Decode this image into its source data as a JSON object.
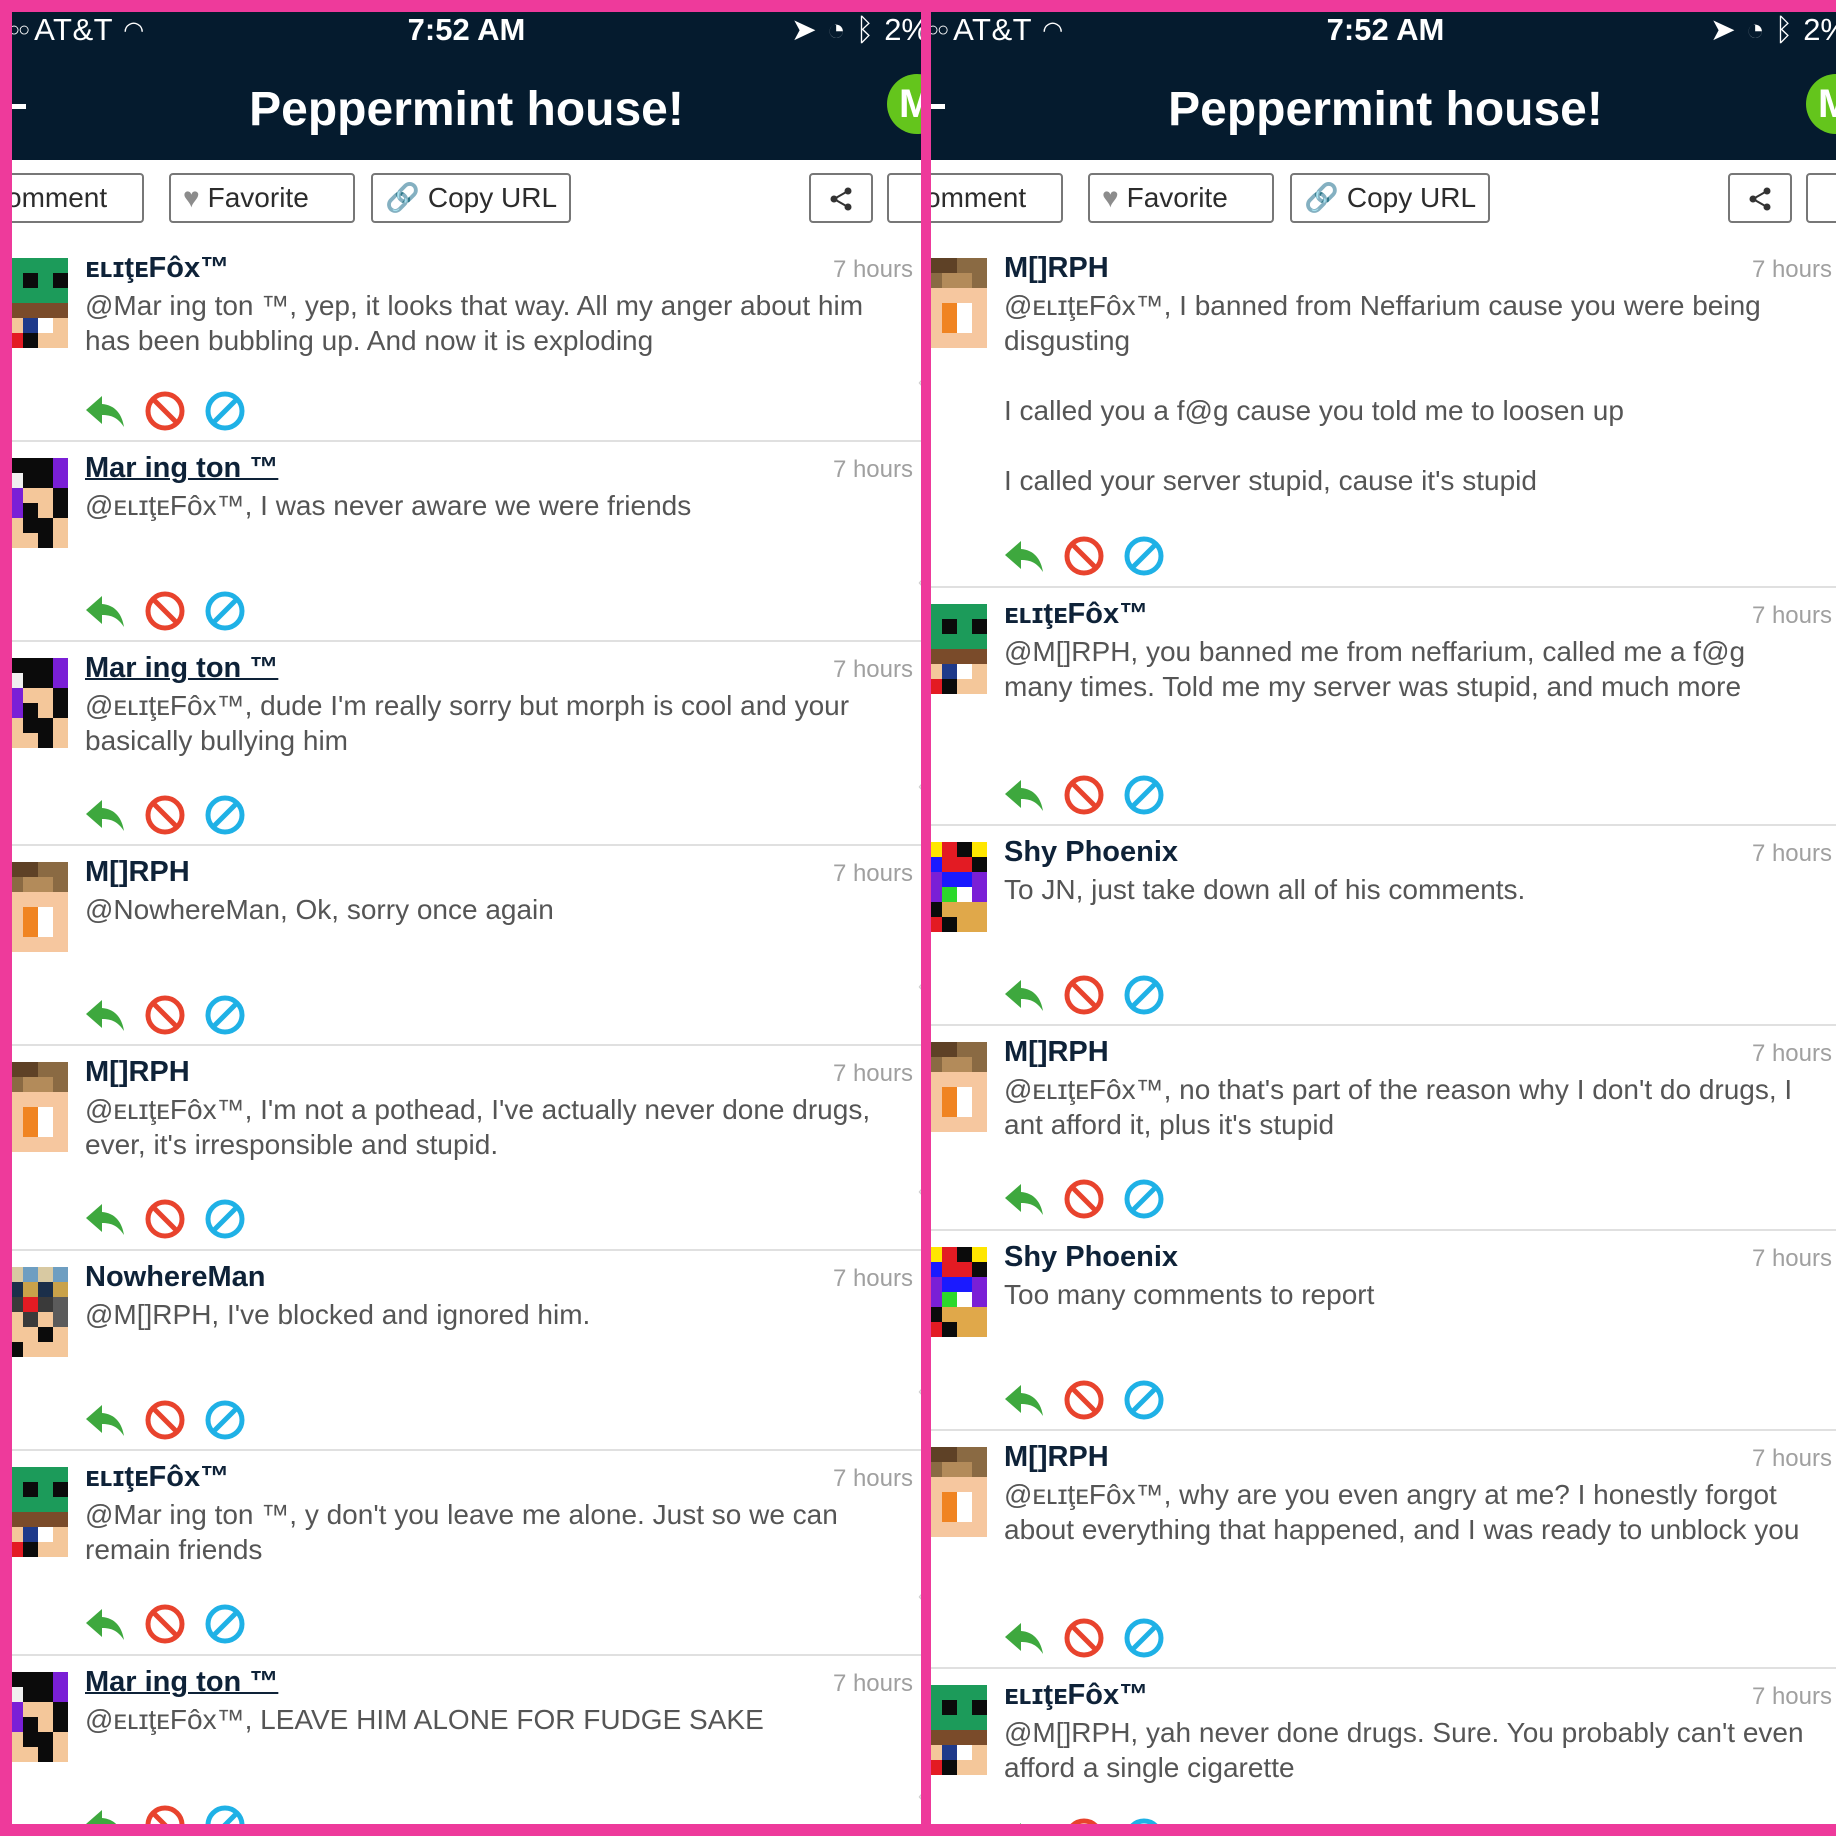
{
  "panels": [
    {
      "status": {
        "carrier": "AT&T",
        "time": "7:52 AM",
        "battery": "2%"
      },
      "title": "Peppermint house!",
      "logo_letter": "M",
      "toolbar": {
        "comment": "omment",
        "favorite": "Favorite",
        "copy_url": "Copy URL"
      },
      "comments": [
        {
          "user": "ᴇʟɪţᴇFôx™",
          "time": "7 hours",
          "avatar": "elitefox",
          "lines": [
            "@Mar ing ton ™, yep, it looks that way. All my anger about him has been bubbling up. And now it is exploding"
          ]
        },
        {
          "user": "Mar ing ton ™",
          "time": "7 hours",
          "avatar": "marington",
          "underlined": true,
          "lines": [
            "@ᴇʟɪţᴇFôx™, I was never aware we were friends"
          ]
        },
        {
          "user": "Mar ing ton ™",
          "time": "7 hours",
          "avatar": "marington",
          "underlined": true,
          "lines": [
            "@ᴇʟɪţᴇFôx™, dude I'm really sorry but morph is cool and your basically bullying him"
          ]
        },
        {
          "user": "M[]RPH",
          "time": "7 hours",
          "avatar": "morph",
          "lines": [
            "@NowhereMan, Ok, sorry once again"
          ]
        },
        {
          "user": "M[]RPH",
          "time": "7 hours",
          "avatar": "morph",
          "lines": [
            "@ᴇʟɪţᴇFôx™, I'm not a pothead, I've actually never done drugs, ever, it's irresponsible and stupid."
          ]
        },
        {
          "user": "NowhereMan",
          "time": "7 hours",
          "avatar": "nowhereman",
          "lines": [
            "@M[]RPH, I've blocked and ignored him."
          ]
        },
        {
          "user": "ᴇʟɪţᴇFôx™",
          "time": "7 hours",
          "avatar": "elitefox",
          "lines": [
            "@Mar ing ton ™, y don't you leave me alone. Just so we can remain friends"
          ]
        },
        {
          "user": "Mar ing ton ™",
          "time": "7 hours",
          "avatar": "marington",
          "underlined": true,
          "lines": [
            "@ᴇʟɪţᴇFôx™, LEAVE HIM ALONE FOR FUDGE SAKE"
          ]
        }
      ]
    },
    {
      "status": {
        "carrier": "AT&T",
        "time": "7:52 AM",
        "battery": "2%"
      },
      "title": "Peppermint house!",
      "logo_letter": "M",
      "toolbar": {
        "comment": "omment",
        "favorite": "Favorite",
        "copy_url": "Copy URL"
      },
      "comments": [
        {
          "user": "M[]RPH",
          "time": "7 hours",
          "avatar": "morph",
          "lines": [
            "@ᴇʟɪţᴇFôx™, I banned from Neffarium cause you were being disgusting",
            "",
            "I called you a f@g cause you told me to loosen up",
            "",
            "I called your server stupid, cause it's stupid"
          ]
        },
        {
          "user": "ᴇʟɪţᴇFôx™",
          "time": "7 hours",
          "avatar": "elitefox",
          "lines": [
            "@M[]RPH, you banned me from neffarium, called me a f@g many times. Told me my server was stupid, and much more"
          ]
        },
        {
          "user": "Shy Phoenix",
          "time": "7 hours",
          "avatar": "shyphoenix",
          "lines": [
            "To JN, just take down all of his comments."
          ]
        },
        {
          "user": "M[]RPH",
          "time": "7 hours",
          "avatar": "morph",
          "lines": [
            "@ᴇʟɪţᴇFôx™, no that's part of the reason why I don't do drugs, I ant afford it, plus it's stupid"
          ]
        },
        {
          "user": "Shy Phoenix",
          "time": "7 hours",
          "avatar": "shyphoenix",
          "lines": [
            "Too many comments to report"
          ]
        },
        {
          "user": "M[]RPH",
          "time": "7 hours",
          "avatar": "morph",
          "lines": [
            "@ᴇʟɪţᴇFôx™, why are you even angry at me? I honestly forgot about everything that happened, and I was ready to unblock you"
          ]
        },
        {
          "user": "ᴇʟɪţᴇFôx™",
          "time": "7 hours",
          "avatar": "elitefox",
          "lines": [
            "@M[]RPH, yah never done drugs. Sure. You probably can't even afford a single cigarette"
          ]
        }
      ]
    }
  ],
  "icons": {
    "reply": "reply-arrow-icon",
    "flag": "flag-icon",
    "block": "block-icon",
    "share": "share-icon",
    "heart": "heart-icon",
    "link": "link-icon"
  },
  "colors": {
    "frame": "#ee3a9b",
    "header": "#051b2e",
    "reply": "#3ea83e",
    "flag": "#e8432d",
    "block": "#1fb1e6",
    "brand": "#64c51c"
  }
}
